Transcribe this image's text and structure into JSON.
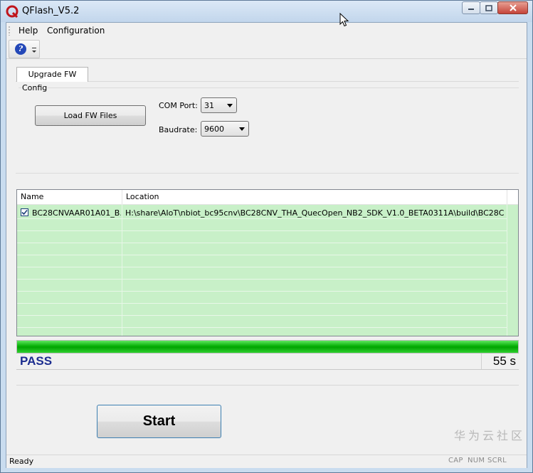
{
  "window": {
    "title": "QFlash_V5.2",
    "app_icon": "qflash-q-logo-icon",
    "controls": [
      "minimize-icon",
      "maximize-icon",
      "close-icon"
    ]
  },
  "menu": {
    "items": [
      "Help",
      "Configuration"
    ]
  },
  "toolbar": {
    "help_icon": "help-question-icon",
    "overflow_icon": "chevron-down-icon"
  },
  "tabs": [
    "Upgrade FW"
  ],
  "config": {
    "group_label": "Config",
    "load_button": "Load FW Files",
    "com_port_label": "COM Port:",
    "com_port_value": "31",
    "baudrate_label": "Baudrate:",
    "baudrate_value": "9600"
  },
  "file_list": {
    "columns": [
      "Name",
      "Location"
    ],
    "rows": [
      {
        "checked": true,
        "name": "BC28CNVAAR01A01_B...",
        "location": "H:\\share\\AIoT\\nbiot_bc95cnv\\BC28CNV_THA_QuecOpen_NB2_SDK_V1.0_BETA0311A\\build\\BC28CNVAAR..."
      }
    ],
    "row_background": "#c8f0c8"
  },
  "progress": {
    "fraction": 1.0,
    "color": "#06b006"
  },
  "result": {
    "status": "PASS",
    "elapsed": "55 s",
    "status_color": "#1c2d8f"
  },
  "start_button": "Start",
  "statusbar": {
    "text": "Ready",
    "indicators": [
      "CAP",
      "NUM",
      "SCRL"
    ]
  },
  "watermark": "华为云社区"
}
